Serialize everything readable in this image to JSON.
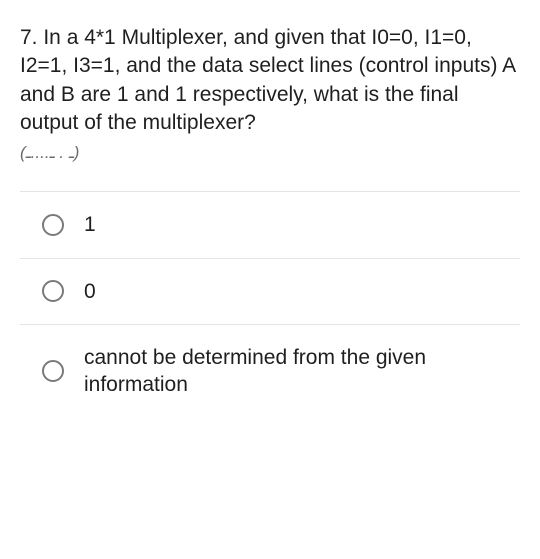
{
  "question": {
    "text": "7. In a 4*1 Multiplexer, and given that I0=0, I1=0, I2=1, I3=1, and the data select lines (control inputs) A and B are 1 and 1 respectively, what is the final output of the multiplexer?"
  },
  "subline": "(ـ . ـ....ـ)",
  "options": [
    {
      "label": "1"
    },
    {
      "label": "0"
    },
    {
      "label": "cannot be determined from the given information"
    }
  ]
}
